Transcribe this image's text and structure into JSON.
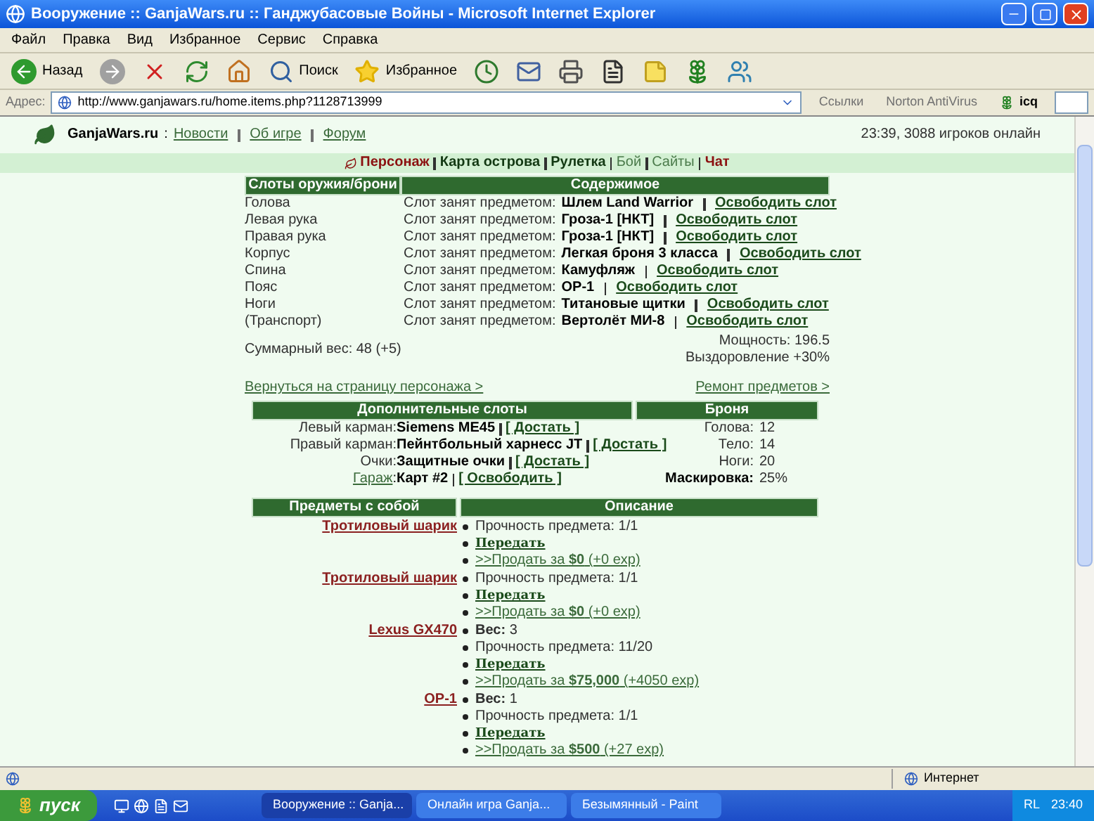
{
  "window": {
    "title": "Вооружение :: GanjaWars.ru :: Ганджубасовые Войны - Microsoft Internet Explorer"
  },
  "menu": [
    "Файл",
    "Правка",
    "Вид",
    "Избранное",
    "Сервис",
    "Справка"
  ],
  "toolbar": [
    {
      "kind": "back",
      "label": "Назад"
    },
    {
      "kind": "forward"
    },
    {
      "kind": "stop"
    },
    {
      "kind": "refresh"
    },
    {
      "kind": "home"
    },
    {
      "kind": "search",
      "label": "Поиск"
    },
    {
      "kind": "favorites",
      "label": "Избранное"
    },
    {
      "kind": "history"
    },
    {
      "kind": "mail"
    },
    {
      "kind": "print"
    },
    {
      "kind": "word"
    },
    {
      "kind": "note"
    },
    {
      "kind": "flower"
    },
    {
      "kind": "messenger"
    }
  ],
  "address": {
    "label": "Адрес:",
    "url": "http://www.ganjawars.ru/home.items.php?1128713999",
    "links": "Ссылки",
    "norton": "Norton AntiVirus",
    "icq": "icq"
  },
  "header": {
    "site": "GanjaWars.ru",
    "separator": ":",
    "links": [
      "Новости",
      "Об игре",
      "Форум"
    ],
    "status": "23:39, 3088 игроков онлайн"
  },
  "nav": [
    {
      "label": "Персонаж",
      "color": "#8b1010",
      "bold": true
    },
    {
      "label": "Карта острова",
      "color": "#123812",
      "bold": true
    },
    {
      "label": "Рулетка",
      "color": "#123812",
      "bold": true
    },
    {
      "label": "Бой",
      "color": "#4a7a4a",
      "bold": false
    },
    {
      "label": "Сайты",
      "color": "#4a7a4a",
      "bold": false
    },
    {
      "label": "Чат",
      "color": "#8b1010",
      "bold": true
    }
  ],
  "slots": {
    "columns": [
      "Слоты оружия/брони",
      "Содержимое"
    ],
    "rows": [
      {
        "slot": "Голова",
        "prefix": "Слот занят предметом:",
        "item": "Шлем Land Warrior",
        "action": "Освободить слот"
      },
      {
        "slot": "Левая рука",
        "prefix": "Слот занят предметом:",
        "item": "Гроза-1 [НКТ]",
        "action": "Освободить слот"
      },
      {
        "slot": "Правая рука",
        "prefix": "Слот занят предметом:",
        "item": "Гроза-1 [НКТ]",
        "action": "Освободить слот"
      },
      {
        "slot": "Корпус",
        "prefix": "Слот занят предметом:",
        "item": "Легкая броня 3 класса",
        "action": "Освободить слот"
      },
      {
        "slot": "Спина",
        "prefix": "Слот занят предметом:",
        "item": "Камуфляж",
        "action": "Освободить слот"
      },
      {
        "slot": "Пояс",
        "prefix": "Слот занят предметом:",
        "item": "ОР-1",
        "action": "Освободить слот"
      },
      {
        "slot": "Ноги",
        "prefix": "Слот занят предметом:",
        "item": "Титановые щитки",
        "action": "Освободить слот"
      },
      {
        "slot": "(Транспорт)",
        "prefix": "Слот занят предметом:",
        "item": "Вертолёт МИ-8",
        "action": "Освободить слот"
      }
    ],
    "weight": "Суммарный вес: 48 (+5)",
    "power": "Мощность: 196.5",
    "recovery": "Выздоровление +30%"
  },
  "links": {
    "back": "Вернуться на страницу персонажа >",
    "repair": "Ремонт предметов >"
  },
  "extra": {
    "title": "Дополнительные слоты",
    "rows": [
      {
        "label": "Левый карман:",
        "label_link": false,
        "item": "Siemens ME45",
        "action": "[ Достать ]"
      },
      {
        "label": "Правый карман:",
        "label_link": false,
        "item": "Пейнтбольный харнесс JT",
        "action": "[ Достать ]"
      },
      {
        "label": "Очки:",
        "label_link": false,
        "item": "Защитные очки",
        "action": "[ Достать ]"
      },
      {
        "label": "Гараж",
        "colon": ":",
        "label_link": true,
        "item": "Карт #2",
        "action": "[ Освободить ]"
      }
    ]
  },
  "armor": {
    "title": "Броня",
    "rows": [
      {
        "label": "Голова:",
        "value": "12",
        "bold": false
      },
      {
        "label": "Тело:",
        "value": "14",
        "bold": false
      },
      {
        "label": "Ноги:",
        "value": "20",
        "bold": false
      },
      {
        "label": "Маскировка:",
        "value": "25%",
        "bold": true
      }
    ]
  },
  "items": {
    "columns": [
      "Предметы с собой",
      "Описание"
    ],
    "rows": [
      {
        "name": "Тротиловый шарик",
        "lines": [
          {
            "kind": "text",
            "text": "Прочность предмета: 1/1"
          },
          {
            "kind": "action",
            "text": "Передать"
          },
          {
            "kind": "sell",
            "text": ">>Продать за **$0** (+0 exp)"
          }
        ]
      },
      {
        "name": "Тротиловый шарик",
        "lines": [
          {
            "kind": "text",
            "text": "Прочность предмета: 1/1"
          },
          {
            "kind": "action",
            "text": "Передать"
          },
          {
            "kind": "sell",
            "text": ">>Продать за **$0** (+0 exp)"
          }
        ]
      },
      {
        "name": "Lexus GX470",
        "lines": [
          {
            "kind": "text",
            "text": "**Вес:** 3"
          },
          {
            "kind": "text",
            "text": "Прочность предмета: 11/20"
          },
          {
            "kind": "action",
            "text": "Передать"
          },
          {
            "kind": "sell",
            "text": ">>Продать за **$75,000** (+4050 exp)"
          }
        ]
      },
      {
        "name": "ОР-1",
        "lines": [
          {
            "kind": "text",
            "text": "**Вес:** 1"
          },
          {
            "kind": "text",
            "text": "Прочность предмета: 1/1"
          },
          {
            "kind": "action",
            "text": "Передать"
          },
          {
            "kind": "sell",
            "text": ">>Продать за **$500** (+27 exp)"
          }
        ]
      }
    ]
  },
  "status_bar": {
    "zone": "Интернет"
  },
  "taskbar": {
    "start": "пуск",
    "windows": [
      {
        "label": "Вооружение :: Ganja...",
        "selected": true
      },
      {
        "label": "Онлайн игра Ganja...",
        "selected": false
      },
      {
        "label": "Безымянный - Paint",
        "selected": false
      }
    ],
    "lang": "RL",
    "clock": "23:40"
  }
}
